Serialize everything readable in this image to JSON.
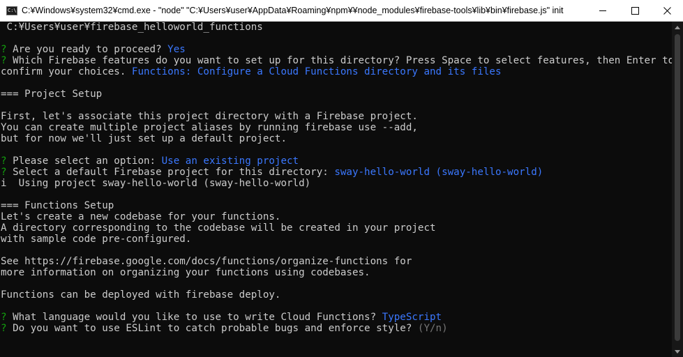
{
  "window": {
    "title": "C:¥Windows¥system32¥cmd.exe  - \"node\"   \"C:¥Users¥user¥AppData¥Roaming¥npm¥¥node_modules¥firebase-tools¥lib¥bin¥firebase.js\" init",
    "app_icon_text": "C:\\"
  },
  "colors": {
    "question_mark": "#13a10e",
    "answer": "#3b78ff",
    "hint": "#767676",
    "text": "#cccccc",
    "background": "#0c0c0c"
  },
  "terminal": {
    "lines": [
      [
        {
          "t": " C:¥Users¥user¥firebase_helloworld_functions",
          "c": ""
        }
      ],
      [],
      [
        {
          "t": "?",
          "c": "q"
        },
        {
          "t": " Are you ready to proceed? ",
          "c": ""
        },
        {
          "t": "Yes",
          "c": "ans"
        }
      ],
      [
        {
          "t": "?",
          "c": "q"
        },
        {
          "t": " Which Firebase features do you want to set up for this directory? Press Space to select features, then Enter to",
          "c": ""
        }
      ],
      [
        {
          "t": "confirm your choices. ",
          "c": ""
        },
        {
          "t": "Functions: Configure a Cloud Functions directory and its files",
          "c": "ans"
        }
      ],
      [],
      [
        {
          "t": "=== Project Setup",
          "c": ""
        }
      ],
      [],
      [
        {
          "t": "First, let's associate this project directory with a Firebase project.",
          "c": ""
        }
      ],
      [
        {
          "t": "You can create multiple project aliases by running firebase use --add,",
          "c": ""
        }
      ],
      [
        {
          "t": "but for now we'll just set up a default project.",
          "c": ""
        }
      ],
      [],
      [
        {
          "t": "?",
          "c": "q"
        },
        {
          "t": " Please select an option: ",
          "c": ""
        },
        {
          "t": "Use an existing project",
          "c": "ans"
        }
      ],
      [
        {
          "t": "?",
          "c": "q"
        },
        {
          "t": " Select a default Firebase project for this directory: ",
          "c": ""
        },
        {
          "t": "sway-hello-world (sway-hello-world)",
          "c": "ans"
        }
      ],
      [
        {
          "t": "i",
          "c": "info"
        },
        {
          "t": "  Using project sway-hello-world (sway-hello-world)",
          "c": ""
        }
      ],
      [],
      [
        {
          "t": "=== Functions Setup",
          "c": ""
        }
      ],
      [
        {
          "t": "Let's create a new codebase for your functions.",
          "c": ""
        }
      ],
      [
        {
          "t": "A directory corresponding to the codebase will be created in your project",
          "c": ""
        }
      ],
      [
        {
          "t": "with sample code pre-configured.",
          "c": ""
        }
      ],
      [],
      [
        {
          "t": "See https://firebase.google.com/docs/functions/organize-functions for",
          "c": ""
        }
      ],
      [
        {
          "t": "more information on organizing your functions using codebases.",
          "c": ""
        }
      ],
      [],
      [
        {
          "t": "Functions can be deployed with firebase deploy.",
          "c": ""
        }
      ],
      [],
      [
        {
          "t": "?",
          "c": "q"
        },
        {
          "t": " What language would you like to use to write Cloud Functions? ",
          "c": ""
        },
        {
          "t": "TypeScript",
          "c": "ans"
        }
      ],
      [
        {
          "t": "?",
          "c": "q"
        },
        {
          "t": " Do you want to use ESLint to catch probable bugs and enforce style? ",
          "c": ""
        },
        {
          "t": "(Y/n)",
          "c": "hint"
        }
      ]
    ]
  }
}
